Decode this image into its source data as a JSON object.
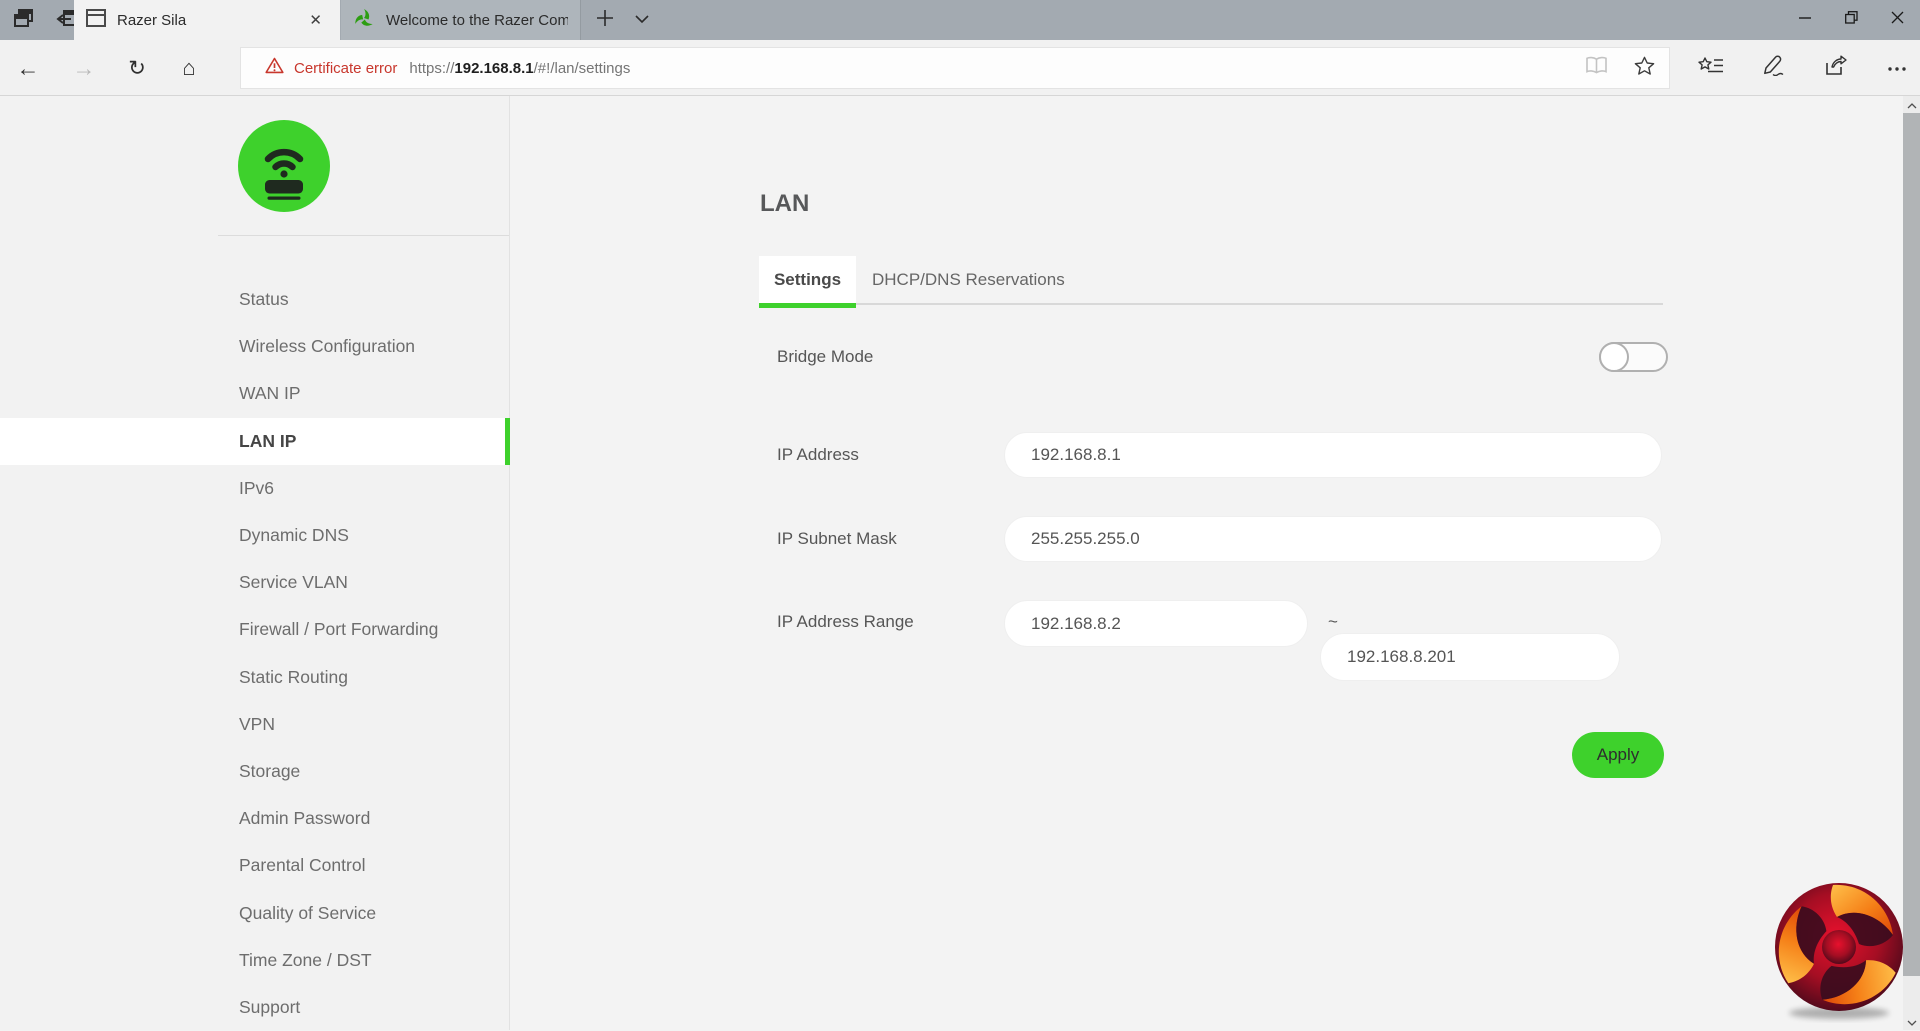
{
  "browser": {
    "tabs": [
      {
        "title": "Razer Sila",
        "active": true
      },
      {
        "title": "Welcome to the Razer Com",
        "active": false
      }
    ],
    "address_bar": {
      "security_label": "Certificate error",
      "url_scheme": "https://",
      "url_host": "192.168.8.1",
      "url_path": "/#!/lan/settings"
    }
  },
  "sidebar": {
    "items": [
      {
        "label": "Status",
        "active": false
      },
      {
        "label": "Wireless Configuration",
        "active": false
      },
      {
        "label": "WAN IP",
        "active": false
      },
      {
        "label": "LAN IP",
        "active": true
      },
      {
        "label": "IPv6",
        "active": false
      },
      {
        "label": "Dynamic DNS",
        "active": false
      },
      {
        "label": "Service VLAN",
        "active": false
      },
      {
        "label": "Firewall / Port Forwarding",
        "active": false
      },
      {
        "label": "Static Routing",
        "active": false
      },
      {
        "label": "VPN",
        "active": false
      },
      {
        "label": "Storage",
        "active": false
      },
      {
        "label": "Admin Password",
        "active": false
      },
      {
        "label": "Parental Control",
        "active": false
      },
      {
        "label": "Quality of Service",
        "active": false
      },
      {
        "label": "Time Zone / DST",
        "active": false
      },
      {
        "label": "Support",
        "active": false
      }
    ]
  },
  "main": {
    "title": "LAN",
    "tabs": [
      {
        "label": "Settings",
        "active": true
      },
      {
        "label": "DHCP/DNS Reservations",
        "active": false
      }
    ],
    "form": {
      "bridge_mode": {
        "label": "Bridge Mode",
        "state": "off"
      },
      "ip_address": {
        "label": "IP Address",
        "value": "192.168.8.1"
      },
      "ip_subnet_mask": {
        "label": "IP Subnet Mask",
        "value": "255.255.255.0"
      },
      "ip_address_range": {
        "label": "IP Address Range",
        "from": "192.168.8.2",
        "separator": "~",
        "to": "192.168.8.201"
      }
    },
    "apply_label": "Apply"
  },
  "colors": {
    "accent_green": "#3ed12c",
    "error_red": "#c8372d",
    "tabbar_gray": "#a3aab1"
  }
}
